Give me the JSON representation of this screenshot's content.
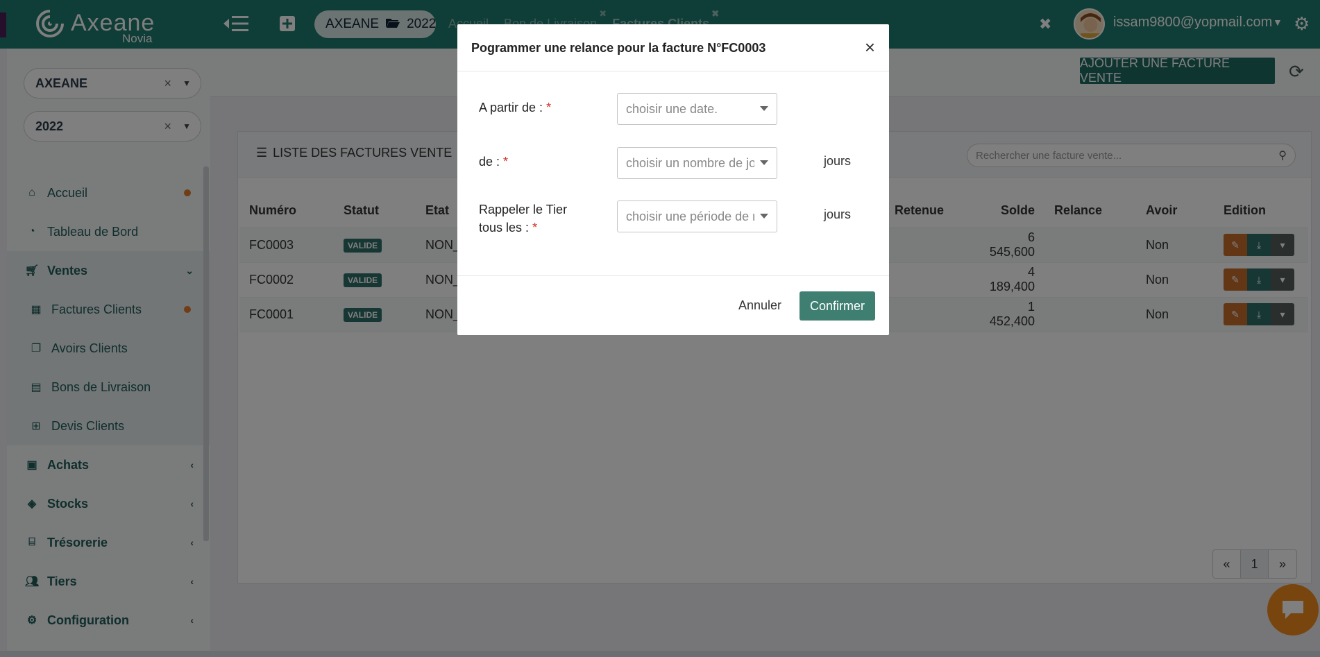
{
  "topbar": {
    "logo_text": "Axeane",
    "logo_sub": "Novia",
    "context_company": "AXEANE",
    "context_year": "2022",
    "tabs": [
      {
        "label": "Accueil"
      },
      {
        "label": "Bon de Livraison"
      },
      {
        "label": "Factures Clients"
      }
    ],
    "user_email": "issam9800@yopmail.com",
    "brand_color": "#1f7a6e"
  },
  "sidebar": {
    "company_select": "AXEANE",
    "year_select": "2022",
    "items": [
      {
        "label": "Accueil",
        "icon": "home-icon"
      },
      {
        "label": "Tableau de Bord",
        "icon": "dashboard-icon"
      },
      {
        "label": "Ventes",
        "icon": "cart-icon"
      },
      {
        "label": "Factures Clients",
        "icon": "calculator-icon"
      },
      {
        "label": "Avoirs Clients",
        "icon": "copy-icon"
      },
      {
        "label": "Bons de Livraison",
        "icon": "file-icon"
      },
      {
        "label": "Devis Clients",
        "icon": "cart-small-icon"
      },
      {
        "label": "Achats",
        "icon": "bag-icon"
      },
      {
        "label": "Stocks",
        "icon": "box-icon"
      },
      {
        "label": "Trésorerie",
        "icon": "bank-icon"
      },
      {
        "label": "Tiers",
        "icon": "users-icon"
      },
      {
        "label": "Configuration",
        "icon": "gear-icon"
      }
    ]
  },
  "main": {
    "add_button": "AJOUTER UNE FACTURE VENTE",
    "panel_title": "LISTE DES FACTURES VENTE",
    "search_placeholder": "Rechercher une facture vente...",
    "columns": [
      "Numéro",
      "Statut",
      "Etat",
      "Retenue",
      "Solde",
      "Relance",
      "Avoir",
      "Edition"
    ],
    "rows": [
      {
        "numero": "FC0003",
        "statut": "VALIDE",
        "etat": "NON_",
        "solde": "6 545,600",
        "avoir": "Non"
      },
      {
        "numero": "FC0002",
        "statut": "VALIDE",
        "etat": "NON_",
        "solde": "4 189,400",
        "avoir": "Non"
      },
      {
        "numero": "FC0001",
        "statut": "VALIDE",
        "etat": "NON_",
        "solde": "1 452,400",
        "avoir": "Non"
      }
    ],
    "pager": {
      "prev": "«",
      "current": "1",
      "next": "»"
    }
  },
  "modal": {
    "title": "Pogrammer une relance pour la facture N°FC0003",
    "close": "×",
    "fields": [
      {
        "label": "A partir de :",
        "required": "*",
        "placeholder": "choisir une date.",
        "unit": ""
      },
      {
        "label": "de :",
        "required": "*",
        "placeholder": "choisir un nombre de jo",
        "unit": "jours"
      },
      {
        "label_line1": "Rappeler le Tier",
        "label_line2": "tous les :",
        "required": "*",
        "placeholder": "choisir une période de r",
        "unit": "jours"
      }
    ],
    "cancel": "Annuler",
    "confirm": "Confirmer"
  }
}
